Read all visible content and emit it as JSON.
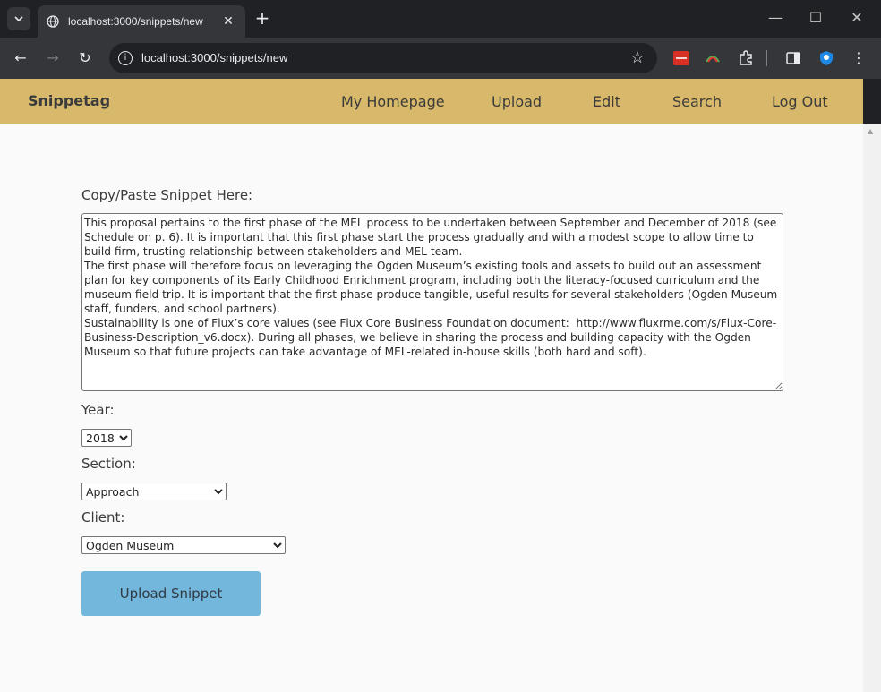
{
  "browser": {
    "tab_title": "localhost:3000/snippets/new",
    "url": "localhost:3000/snippets/new"
  },
  "navbar": {
    "brand": "Snippetag",
    "links": [
      "My Homepage",
      "Upload",
      "Edit",
      "Search",
      "Log Out"
    ]
  },
  "form": {
    "snippet_label": "Copy/Paste Snippet Here:",
    "snippet_value": "This proposal pertains to the first phase of the MEL process to be undertaken between September and December of 2018 (see Schedule on p. 6). It is important that this first phase start the process gradually and with a modest scope to allow time to build firm, trusting relationship between stakeholders and MEL team.\nThe first phase will therefore focus on leveraging the Ogden Museum’s existing tools and assets to build out an assessment plan for key components of its Early Childhood Enrichment program, including both the literacy-focused curriculum and the museum field trip. It is important that the first phase produce tangible, useful results for several stakeholders (Ogden Museum staff, funders, and school partners).\nSustainability is one of Flux’s core values (see Flux Core Business Foundation document:  http://www.fluxrme.com/s/Flux-Core-Business-Description_v6.docx). During all phases, we believe in sharing the process and building capacity with the Ogden Museum so that future projects can take advantage of MEL-related in-house skills (both hard and soft).",
    "year_label": "Year:",
    "year_value": "2018",
    "section_label": "Section:",
    "section_value": "Approach",
    "client_label": "Client:",
    "client_value": "Ogden Museum",
    "submit_label": "Upload Snippet"
  },
  "colors": {
    "navbar_bg": "#d8b86a",
    "submit_bg": "#73b7dc"
  }
}
